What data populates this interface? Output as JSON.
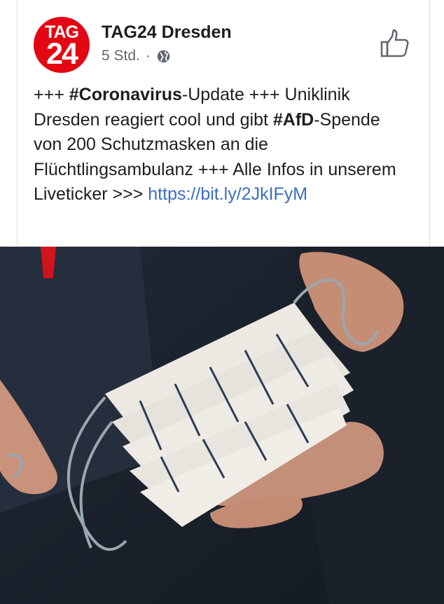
{
  "page": {
    "name": "TAG24 Dresden",
    "logo_line1": "TAG",
    "logo_line2": "24",
    "time": "5 Std.",
    "separator": "·",
    "audience_icon": "globe-icon",
    "like_icon": "thumbs-up-icon"
  },
  "post": {
    "p1": "+++ ",
    "tag1": "#Coronavirus",
    "p2": "-Update +++ Uniklinik Dresden reagiert cool und gibt ",
    "tag2": "#AfD",
    "p3": "-Spende von 200 Schutzmasken an die Flüchtlingsambulanz +++ Alle Infos in unserem Liveticker >>> ",
    "link": "https://bit.ly/2JkIFyM"
  },
  "colors": {
    "brand_red": "#e30613",
    "link_blue": "#3a6ec2",
    "meta_gray": "#606770"
  }
}
